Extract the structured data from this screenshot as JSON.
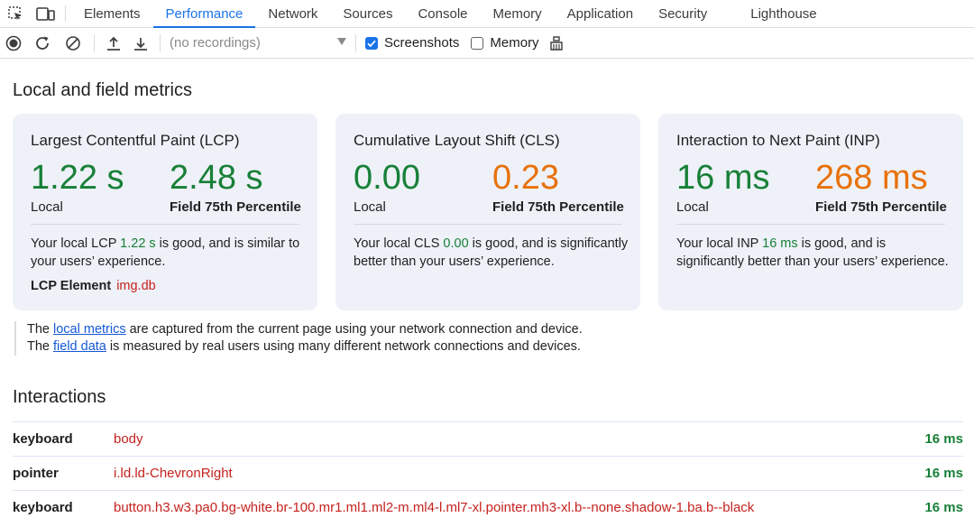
{
  "tabs": [
    "Elements",
    "Performance",
    "Network",
    "Sources",
    "Console",
    "Memory",
    "Application",
    "Security",
    "Lighthouse"
  ],
  "active_tab": "Performance",
  "toolbar": {
    "recordings_placeholder": "(no recordings)",
    "screenshots_label": "Screenshots",
    "memory_label": "Memory"
  },
  "main": {
    "section_title": "Local and field metrics",
    "cards": [
      {
        "title": "Largest Contentful Paint (LCP)",
        "local_value": "1.22 s",
        "local_label": "Local",
        "field_value": "2.48 s",
        "field_label": "Field 75th Percentile",
        "desc_pre": "Your local LCP ",
        "desc_value": "1.22 s",
        "desc_post": " is good, and is similar to your users’ experience.",
        "element_label": "LCP Element",
        "element_value": "img.db"
      },
      {
        "title": "Cumulative Layout Shift (CLS)",
        "local_value": "0.00",
        "local_label": "Local",
        "field_value": "0.23",
        "field_label": "Field 75th Percentile",
        "desc_pre": "Your local CLS ",
        "desc_value": "0.00",
        "desc_post": " is good, and is significantly better than your users’ experience."
      },
      {
        "title": "Interaction to Next Paint (INP)",
        "local_value": "16 ms",
        "local_label": "Local",
        "field_value": "268 ms",
        "field_label": "Field 75th Percentile",
        "desc_pre": "Your local INP ",
        "desc_value": "16 ms",
        "desc_post": " is good, and is significantly better than your users’ experience."
      }
    ],
    "note": {
      "line1_pre": "The ",
      "line1_link": "local metrics",
      "line1_post": " are captured from the current page using your network connection and device.",
      "line2_pre": "The ",
      "line2_link": "field data",
      "line2_post": " is measured by real users using many different network connections and devices."
    },
    "interactions_title": "Interactions",
    "interactions": [
      {
        "type": "keyboard",
        "node": "body",
        "duration": "16 ms"
      },
      {
        "type": "pointer",
        "node": "i.ld.ld-ChevronRight",
        "duration": "16 ms"
      },
      {
        "type": "keyboard",
        "node": "button.h3.w3.pa0.bg-white.br-100.mr1.ml1.ml2-m.ml4-l.ml7-xl.pointer.mh3-xl.b--none.shadow-1.ba.b--black",
        "duration": "16 ms"
      }
    ]
  },
  "colors": {
    "accent": "#1a73e8",
    "good": "#188038",
    "needs_improvement": "#e8710a",
    "node": "#c5221f",
    "card_bg": "#eef1f8"
  }
}
